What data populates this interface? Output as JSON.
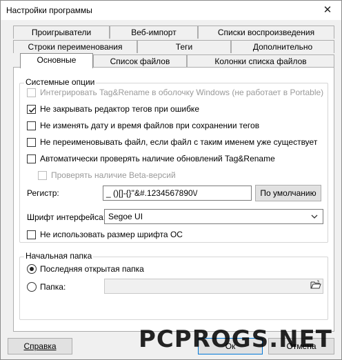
{
  "window": {
    "title": "Настройки программы"
  },
  "tabs": {
    "row1": [
      "Проигрыватели",
      "Веб-импорт",
      "Списки воспроизведения"
    ],
    "row2": [
      "Строки переименования",
      "Теги",
      "Дополнительно"
    ],
    "row3": [
      "Основные",
      "Список файлов",
      "Колонки списка файлов"
    ],
    "active": "Основные"
  },
  "system": {
    "group_label": "Системные опции",
    "integrate_label": "Интегрировать Tag&Rename в оболочку Windows (не работает в Portable)",
    "no_close_editor_label": "Не закрывать редактор тегов при ошибке",
    "no_change_date_label": "Не изменять дату и время файлов при сохранении тегов",
    "no_rename_label": "Не переименовывать файл, если файл с таким именем уже существует",
    "auto_update_label": "Автоматически проверять наличие обновлений Tag&Rename",
    "beta_label": "Проверять наличие Beta-версий",
    "register_label": "Регистр:",
    "register_value": "_ ()[]-{}\"&#.1234567890\\/",
    "default_button": "По умолчанию",
    "font_label": "Шрифт интерфейса:",
    "font_value": "Segoe UI",
    "no_os_font_label": "Не использовать размер шрифта ОС"
  },
  "start_folder": {
    "group_label": "Начальная папка",
    "last_opened_label": "Последняя открытая папка",
    "folder_label": "Папка:",
    "folder_value": ""
  },
  "footer": {
    "help_button": "Справка",
    "ok_button": "Ок",
    "cancel_button": "Отмена"
  },
  "watermark": "PCPROGS.NET"
}
